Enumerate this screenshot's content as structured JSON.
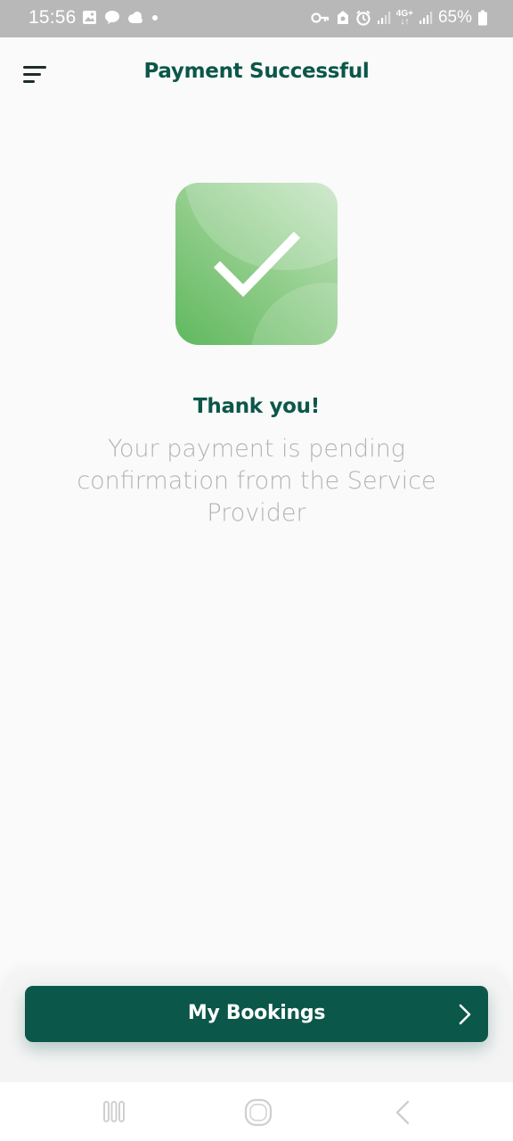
{
  "status_bar": {
    "time": "15:56",
    "battery": "65%",
    "network": "4G+",
    "left_icons": [
      "gallery-icon",
      "chat-bubble-icon",
      "cloud-icon",
      "dot-icon"
    ],
    "right_icons": [
      "key-icon",
      "alarm-lock-icon",
      "alarm-icon",
      "signal-icon",
      "network-4g-icon",
      "signal-icon",
      "battery-icon"
    ]
  },
  "header": {
    "title": "Payment Successful",
    "menu_icon": "menu-icon"
  },
  "success": {
    "icon": "checkmark-icon",
    "accent_color": "#5fb95e"
  },
  "message": {
    "heading": "Thank you!",
    "body": "Your payment is pending confirmation from the Service Provider"
  },
  "action": {
    "label": "My Bookings",
    "icon": "chevron-right-icon",
    "color": "#0b5749"
  },
  "nav_bar": {
    "buttons": [
      "recent-apps-icon",
      "home-icon",
      "back-icon"
    ]
  }
}
